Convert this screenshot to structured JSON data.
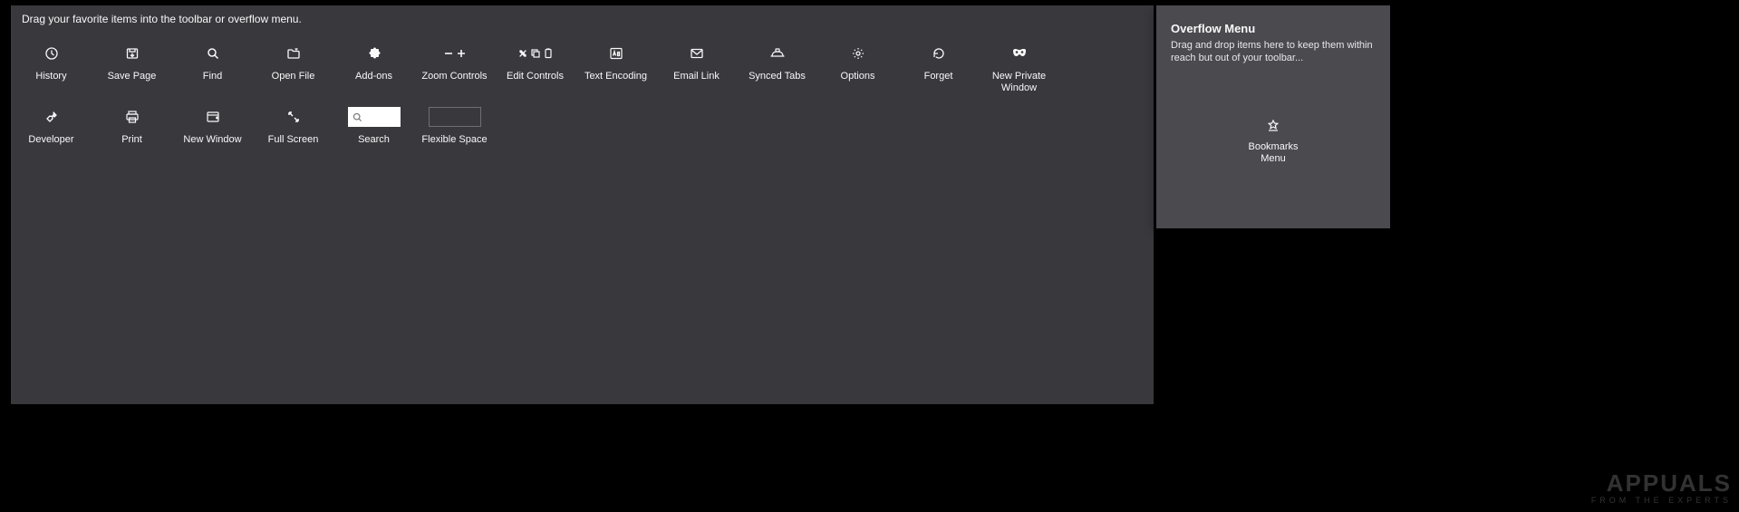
{
  "instruction": "Drag your favorite items into the toolbar or overflow menu.",
  "items": {
    "history": "History",
    "savepage": "Save Page",
    "find": "Find",
    "openfile": "Open File",
    "addons": "Add-ons",
    "zoom": "Zoom Controls",
    "edit": "Edit Controls",
    "encoding": "Text Encoding",
    "emaillink": "Email Link",
    "synced": "Synced Tabs",
    "options": "Options",
    "forget": "Forget",
    "newprivate": "New Private\nWindow",
    "developer": "Developer",
    "print": "Print",
    "newwindow": "New Window",
    "fullscreen": "Full Screen",
    "search": "Search",
    "flexspace": "Flexible Space"
  },
  "overflow": {
    "title": "Overflow Menu",
    "desc": "Drag and drop items here to keep them within reach but out of your toolbar...",
    "bookmarks": "Bookmarks\nMenu"
  },
  "watermark": {
    "big": "APPUALS",
    "small": "FROM THE EXPERTS"
  }
}
